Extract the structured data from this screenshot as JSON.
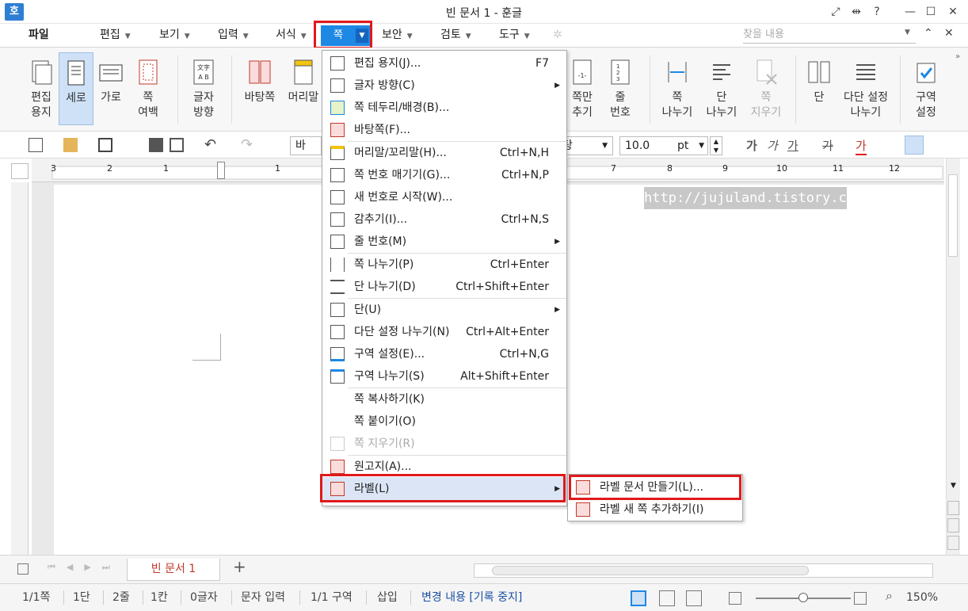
{
  "window": {
    "title": "빈 문서 1 - 훈글",
    "logo": "호"
  },
  "menu": {
    "file": "파일",
    "items": [
      {
        "label": "편집"
      },
      {
        "label": "보기"
      },
      {
        "label": "입력"
      },
      {
        "label": "서식"
      },
      {
        "label": "쪽"
      },
      {
        "label": "보안"
      },
      {
        "label": "검토"
      },
      {
        "label": "도구"
      }
    ],
    "search_placeholder": "찾을 내용"
  },
  "ribbon": {
    "buttons": [
      {
        "label1": "편집",
        "label2": "용지"
      },
      {
        "label1": "세로",
        "label2": ""
      },
      {
        "label1": "가로",
        "label2": ""
      },
      {
        "label1": "쪽",
        "label2": "여백"
      },
      {
        "label1": "글자",
        "label2": "방향"
      },
      {
        "label1": "바탕쪽",
        "label2": ""
      },
      {
        "label1": "머리말",
        "label2": ""
      },
      {
        "label1": "쪽만",
        "label2": "추기"
      },
      {
        "label1": "줄",
        "label2": "번호"
      },
      {
        "label1": "쪽",
        "label2": "나누기"
      },
      {
        "label1": "단",
        "label2": "나누기"
      },
      {
        "label1": "쪽",
        "label2": "지우기"
      },
      {
        "label1": "단",
        "label2": ""
      },
      {
        "label1": "다단 설정",
        "label2": "나누기"
      },
      {
        "label1": "구역",
        "label2": "설정"
      }
    ]
  },
  "toolbar": {
    "style_name": "바",
    "font_size": "10.0",
    "font_unit": "pt",
    "font_name_tail": "탕"
  },
  "ruler": {
    "numbers": [
      "3",
      "2",
      "1",
      "1",
      "7",
      "8",
      "9",
      "10",
      "11",
      "12"
    ]
  },
  "watermark": "http://jujuland.tistory.com",
  "page_menu": {
    "items": [
      {
        "label": "편집 용지(J)...",
        "shortcut": "F7",
        "submenu": false,
        "disabled": false
      },
      {
        "label": "글자 방향(C)",
        "shortcut": "",
        "submenu": true,
        "disabled": false
      },
      {
        "label": "쪽 테두리/배경(B)...",
        "shortcut": "",
        "submenu": false,
        "disabled": false
      },
      {
        "label": "바탕쪽(F)...",
        "shortcut": "",
        "submenu": false,
        "disabled": false
      },
      {
        "label": "머리말/꼬리말(H)...",
        "shortcut": "Ctrl+N,H",
        "submenu": false,
        "disabled": false
      },
      {
        "label": "쪽 번호 매기기(G)...",
        "shortcut": "Ctrl+N,P",
        "submenu": false,
        "disabled": false
      },
      {
        "label": "새 번호로 시작(W)...",
        "shortcut": "",
        "submenu": false,
        "disabled": false
      },
      {
        "label": "감추기(I)...",
        "shortcut": "Ctrl+N,S",
        "submenu": false,
        "disabled": false
      },
      {
        "label": "줄 번호(M)",
        "shortcut": "",
        "submenu": true,
        "disabled": false
      },
      {
        "label": "쪽 나누기(P)",
        "shortcut": "Ctrl+Enter",
        "submenu": false,
        "disabled": false
      },
      {
        "label": "단 나누기(D)",
        "shortcut": "Ctrl+Shift+Enter",
        "submenu": false,
        "disabled": false
      },
      {
        "label": "단(U)",
        "shortcut": "",
        "submenu": true,
        "disabled": false
      },
      {
        "label": "다단 설정 나누기(N)",
        "shortcut": "Ctrl+Alt+Enter",
        "submenu": false,
        "disabled": false
      },
      {
        "label": "구역 설정(E)...",
        "shortcut": "Ctrl+N,G",
        "submenu": false,
        "disabled": false
      },
      {
        "label": "구역 나누기(S)",
        "shortcut": "Alt+Shift+Enter",
        "submenu": false,
        "disabled": false
      },
      {
        "label": "쪽 복사하기(K)",
        "shortcut": "",
        "submenu": false,
        "disabled": false
      },
      {
        "label": "쪽 붙이기(O)",
        "shortcut": "",
        "submenu": false,
        "disabled": false
      },
      {
        "label": "쪽 지우기(R)",
        "shortcut": "",
        "submenu": false,
        "disabled": true
      },
      {
        "label": "원고지(A)...",
        "shortcut": "",
        "submenu": false,
        "disabled": false
      },
      {
        "label": "라벨(L)",
        "shortcut": "",
        "submenu": true,
        "disabled": false
      }
    ]
  },
  "label_submenu": {
    "items": [
      {
        "label": "라벨 문서 만들기(L)..."
      },
      {
        "label": "라벨 새 쪽 추가하기(I)"
      }
    ]
  },
  "tabs": {
    "doc_tab": "빈 문서 1",
    "add": "+"
  },
  "status": {
    "page": "1/1쪽",
    "column": "1단",
    "line": "2줄",
    "char_col": "1칸",
    "chars": "0글자",
    "mode": "문자 입력",
    "section": "1/1 구역",
    "insert": "삽입",
    "track": "변경 내용 [기록 중지]",
    "zoom": "150%"
  },
  "colors": {
    "accent": "#1e88e5",
    "highlight": "#e0191d",
    "tab_text": "#c0392b",
    "track_text": "#1a4fa3"
  }
}
